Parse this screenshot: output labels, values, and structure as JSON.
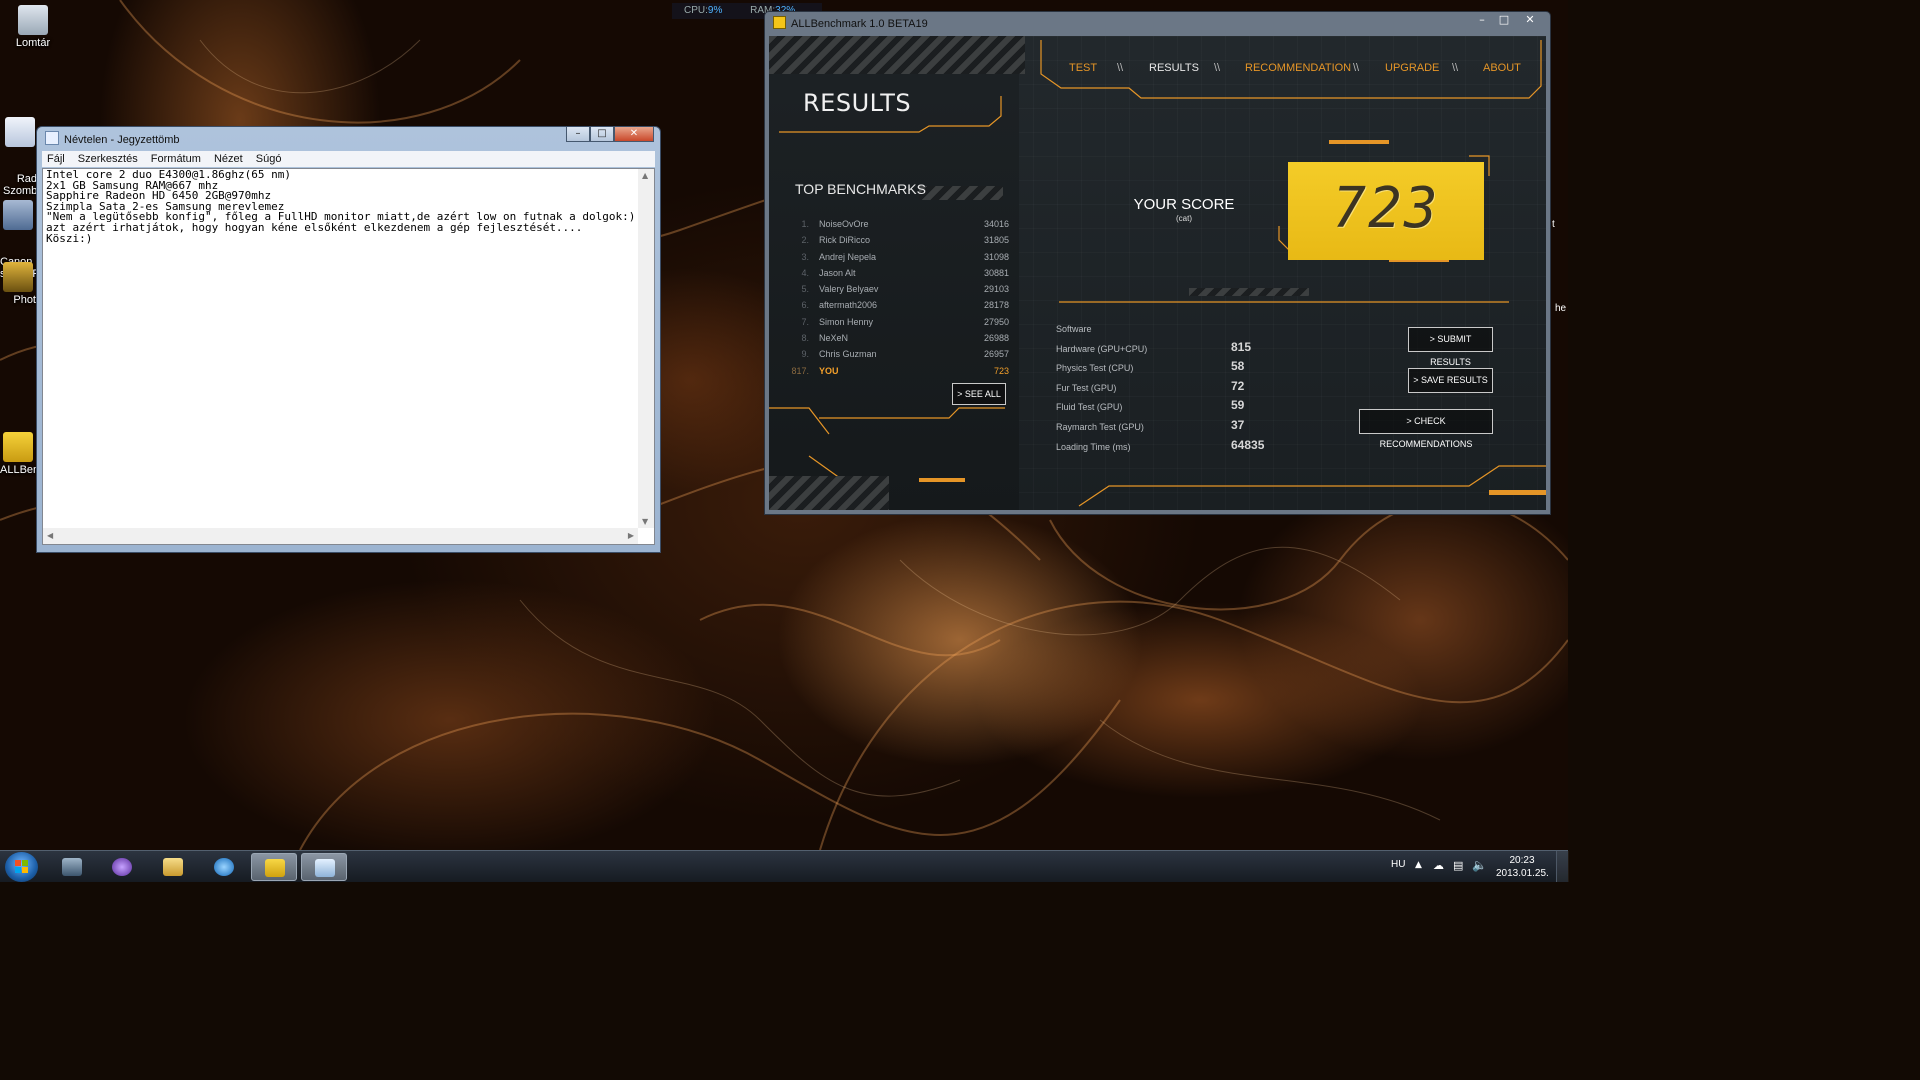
{
  "desktop": {
    "icons": [
      {
        "label": "Lomtár"
      },
      {
        "label": "Rad\nSzomb"
      },
      {
        "label": "Canon\nseries F"
      },
      {
        "label": "Phot"
      },
      {
        "label": "ALLBen"
      }
    ],
    "right_edge_text": [
      "t",
      "he"
    ]
  },
  "gadget": {
    "cpu_label": "CPU:",
    "cpu_value": "9%",
    "ram_label": "RAM:",
    "ram_value": "32%"
  },
  "notepad": {
    "title": "Névtelen - Jegyzettömb",
    "menu": [
      "Fájl",
      "Szerkesztés",
      "Formátum",
      "Nézet",
      "Súgó"
    ],
    "content": "Intel core 2 duo E4300@1.86ghz(65 nm)\n2x1 GB Samsung RAM@667 mhz\nSapphire Radeon HD 6450 2GB@970mhz\nSzimpla Sata 2-es Samsung merevlemez\n\"Nem a legütősebb konfig\", főleg a FullHD monitor miatt,de azért low on futnak a dolgok:)\nazt azért irhatjátok, hogy hogyan kéne elsőként elkezdenem a gép fejlesztését....\nKöszi:)"
  },
  "allbenchmark": {
    "title": "ALLBenchmark 1.0 BETA19",
    "nav": [
      {
        "label": "TEST",
        "active": false
      },
      {
        "label": "RESULTS",
        "active": true
      },
      {
        "label": "RECOMMENDATION",
        "active": false
      },
      {
        "label": "UPGRADE",
        "active": false
      },
      {
        "label": "ABOUT",
        "active": false
      }
    ],
    "nav_sep": "\\\\",
    "results_heading": "RESULTS",
    "top_benchmarks_heading": "TOP BENCHMARKS",
    "top_benchmarks": [
      {
        "rank": "1.",
        "name": "NoiseOvOre",
        "score": "34016"
      },
      {
        "rank": "2.",
        "name": "Rick DiRicco",
        "score": "31805"
      },
      {
        "rank": "3.",
        "name": "Andrej Nepela",
        "score": "31098"
      },
      {
        "rank": "4.",
        "name": "Jason Alt",
        "score": "30881"
      },
      {
        "rank": "5.",
        "name": "Valery Belyaev",
        "score": "29103"
      },
      {
        "rank": "6.",
        "name": "aftermath2006",
        "score": "28178"
      },
      {
        "rank": "7.",
        "name": "Simon Henny",
        "score": "27950"
      },
      {
        "rank": "8.",
        "name": "NeXeN",
        "score": "26988"
      },
      {
        "rank": "9.",
        "name": "Chris Guzman",
        "score": "26957"
      },
      {
        "rank": "817.",
        "name": "YOU",
        "score": "723"
      }
    ],
    "see_all": "> SEE ALL",
    "your_score_label": "YOUR SCORE",
    "your_score_sub": "(cat)",
    "score": "723",
    "stats": [
      {
        "label": "Software",
        "value": ""
      },
      {
        "label": "Hardware (GPU+CPU)",
        "value": "815"
      },
      {
        "label": "Physics Test (CPU)",
        "value": "58"
      },
      {
        "label": "Fur Test (GPU)",
        "value": "72"
      },
      {
        "label": "Fluid Test (GPU)",
        "value": "59"
      },
      {
        "label": "Raymarch Test (GPU)",
        "value": "37"
      },
      {
        "label": "Loading Time (ms)",
        "value": "64835"
      }
    ],
    "buttons": {
      "submit": "> SUBMIT RESULTS",
      "save": "> SAVE RESULTS",
      "check": "> CHECK RECOMMENDATIONS"
    },
    "accent": "#e59527",
    "score_bg": "#f2c41f"
  },
  "taskbar": {
    "lang": "HU",
    "time": "20:23",
    "date": "2013.01.25."
  }
}
